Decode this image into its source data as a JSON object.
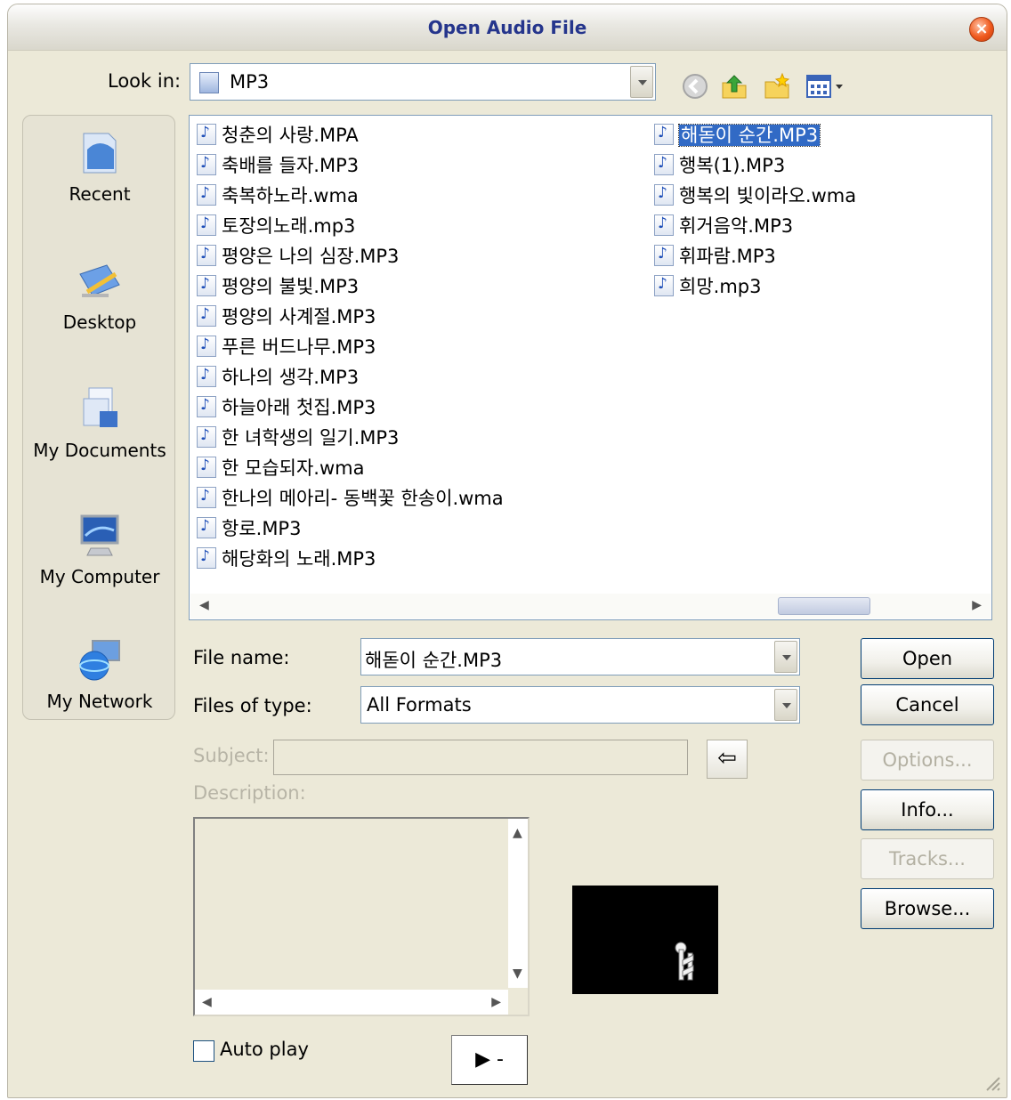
{
  "window": {
    "title": "Open Audio File"
  },
  "look_in": {
    "label": "Look in:",
    "value": "MP3"
  },
  "toolbar": {
    "icons": [
      "back-icon",
      "up-folder-icon",
      "new-folder-icon",
      "view-menu-icon"
    ]
  },
  "places": [
    {
      "label": "Recent",
      "icon": "recent-icon"
    },
    {
      "label": "Desktop",
      "icon": "desktop-icon"
    },
    {
      "label": "My Documents",
      "icon": "my-documents-icon"
    },
    {
      "label": "My Computer",
      "icon": "my-computer-icon"
    },
    {
      "label": "My Network",
      "icon": "my-network-icon"
    }
  ],
  "files": {
    "col1": [
      "청춘의 사랑.MPA",
      "축배를 들자.MP3",
      "축복하노라.wma",
      "토장의노래.mp3",
      "평양은 나의 심장.MP3",
      "평양의 불빛.MP3",
      "평양의 사계절.MP3",
      "푸른 버드나무.MP3",
      "하나의 생각.MP3",
      "하늘아래 첫집.MP3",
      "한 녀학생의 일기.MP3",
      "한 모습되자.wma",
      "한나의 메아리- 동백꽃 한송이.wma",
      "항로.MP3",
      "해당화의 노래.MP3"
    ],
    "col2": [
      "해돋이 순간.MP3",
      "행복(1).MP3",
      "행복의 빛이라오.wma",
      "휘거음악.MP3",
      "휘파람.MP3",
      "희망.mp3"
    ],
    "selected": "해돋이 순간.MP3"
  },
  "file_name": {
    "label": "File name:",
    "value": "해돋이 순간.MP3"
  },
  "files_of_type": {
    "label": "Files of type:",
    "value": "All Formats"
  },
  "subject": {
    "label": "Subject:",
    "value": ""
  },
  "description": {
    "label": "Description:"
  },
  "buttons": {
    "open": "Open",
    "cancel": "Cancel",
    "options": "Options...",
    "info": "Info...",
    "tracks": "Tracks...",
    "browse": "Browse..."
  },
  "autoplay": {
    "label": "Auto play",
    "checked": false
  },
  "play_button": {
    "label": "▶ -"
  }
}
